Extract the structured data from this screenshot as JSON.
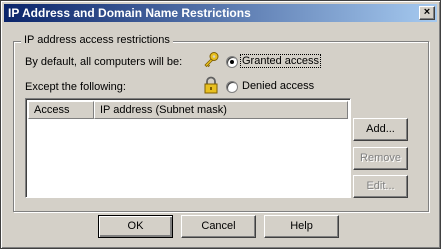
{
  "window": {
    "title": "IP Address and Domain Name Restrictions",
    "close_glyph": "×"
  },
  "group": {
    "legend": "IP address access restrictions",
    "default_label": "By default, all computers will be:",
    "except_label": "Except the following:"
  },
  "options": {
    "granted": {
      "label": "Granted access",
      "selected": true
    },
    "denied": {
      "label": "Denied access",
      "selected": false
    }
  },
  "icons": {
    "granted": "key-icon",
    "denied": "padlock-icon"
  },
  "list": {
    "columns": [
      "Access",
      "IP address (Subnet mask)"
    ],
    "rows": []
  },
  "side_buttons": {
    "add": "Add...",
    "remove": "Remove",
    "edit": "Edit..."
  },
  "footer_buttons": {
    "ok": "OK",
    "cancel": "Cancel",
    "help": "Help"
  },
  "colors": {
    "face": "#d4d0c8",
    "title_start": "#0a246a",
    "title_end": "#a6caf0"
  }
}
